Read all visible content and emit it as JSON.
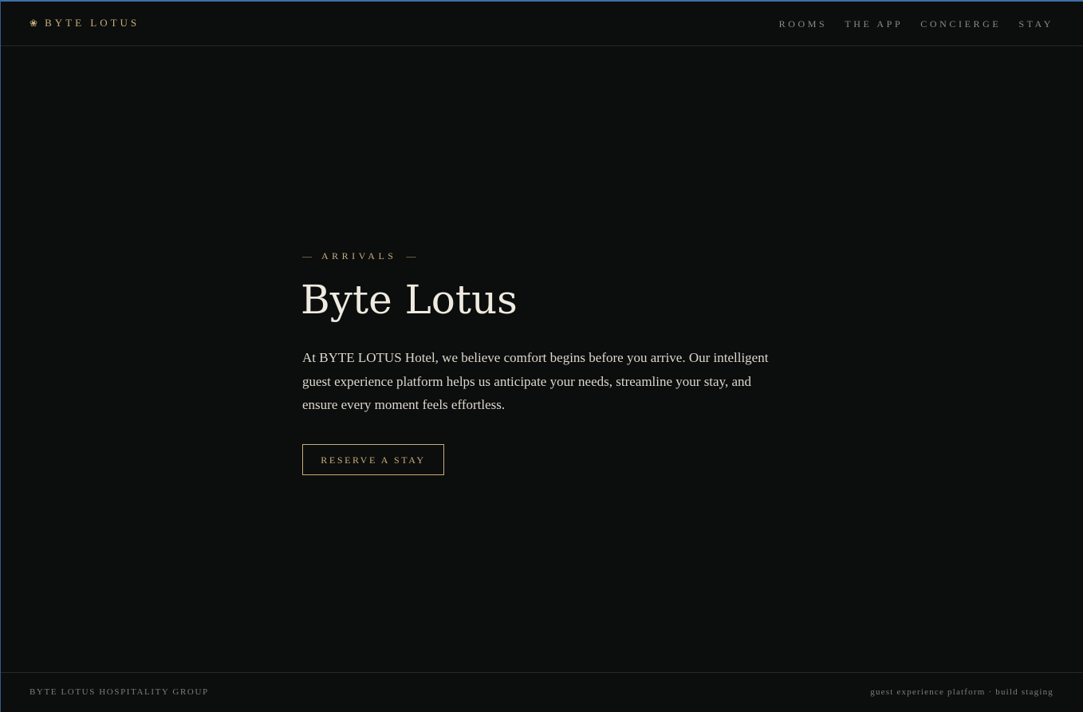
{
  "header": {
    "brand_icon": "lotus-icon",
    "brand_name": "BYTE LOTUS",
    "nav": [
      {
        "label": "ROOMS"
      },
      {
        "label": "THE APP"
      },
      {
        "label": "CONCIERGE"
      },
      {
        "label": "STAY"
      }
    ]
  },
  "hero": {
    "eyebrow": "ARRIVALS",
    "title": "Byte Lotus",
    "lead": "At BYTE LOTUS Hotel, we believe comfort begins before you arrive. Our intelligent guest experience platform helps us anticipate your needs, streamline your stay, and ensure every moment feels effortless.",
    "cta_label": "RESERVE A STAY"
  },
  "footer": {
    "left": "BYTE LOTUS HOSPITALITY GROUP",
    "right": "guest experience platform · build staging"
  },
  "colors": {
    "background": "#0c0d0d",
    "accent_gold": "#c9ad7a",
    "text_primary": "#efeae0",
    "text_muted": "#8a8c8b",
    "frame_blue": "#3d6fa6"
  }
}
